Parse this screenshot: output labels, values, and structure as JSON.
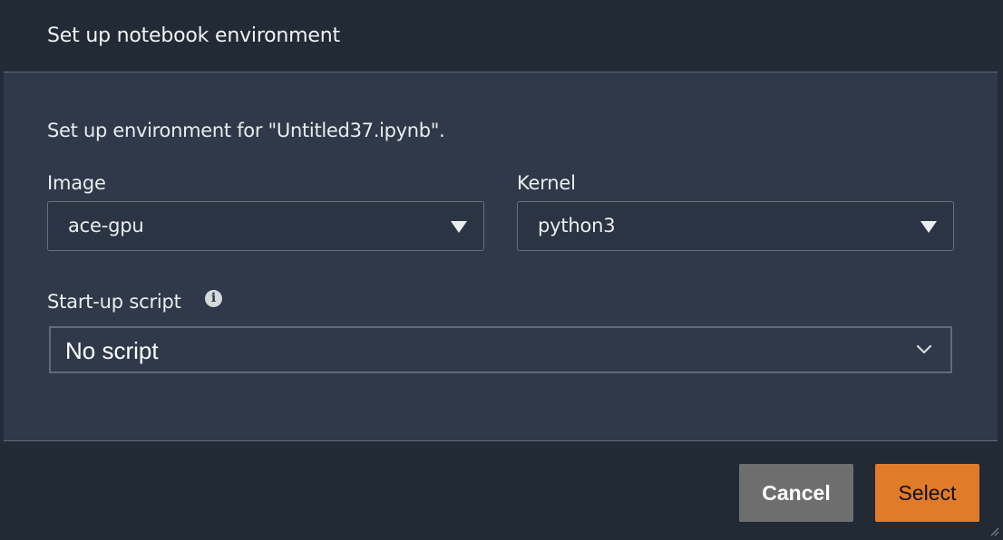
{
  "dialog": {
    "title": "Set up notebook environment",
    "intro": "Set up environment for \"Untitled37.ipynb\"."
  },
  "fields": {
    "image": {
      "label": "Image",
      "value": "ace-gpu"
    },
    "kernel": {
      "label": "Kernel",
      "value": "python3"
    },
    "startup": {
      "label": "Start-up script",
      "value": "No script",
      "info_icon": "info-icon"
    }
  },
  "footer": {
    "cancel_label": "Cancel",
    "select_label": "Select"
  },
  "colors": {
    "accent": "#e07b2a",
    "cancel_bg": "#6e6e6e",
    "body_bg": "#2f394a",
    "header_bg": "#222a35"
  }
}
